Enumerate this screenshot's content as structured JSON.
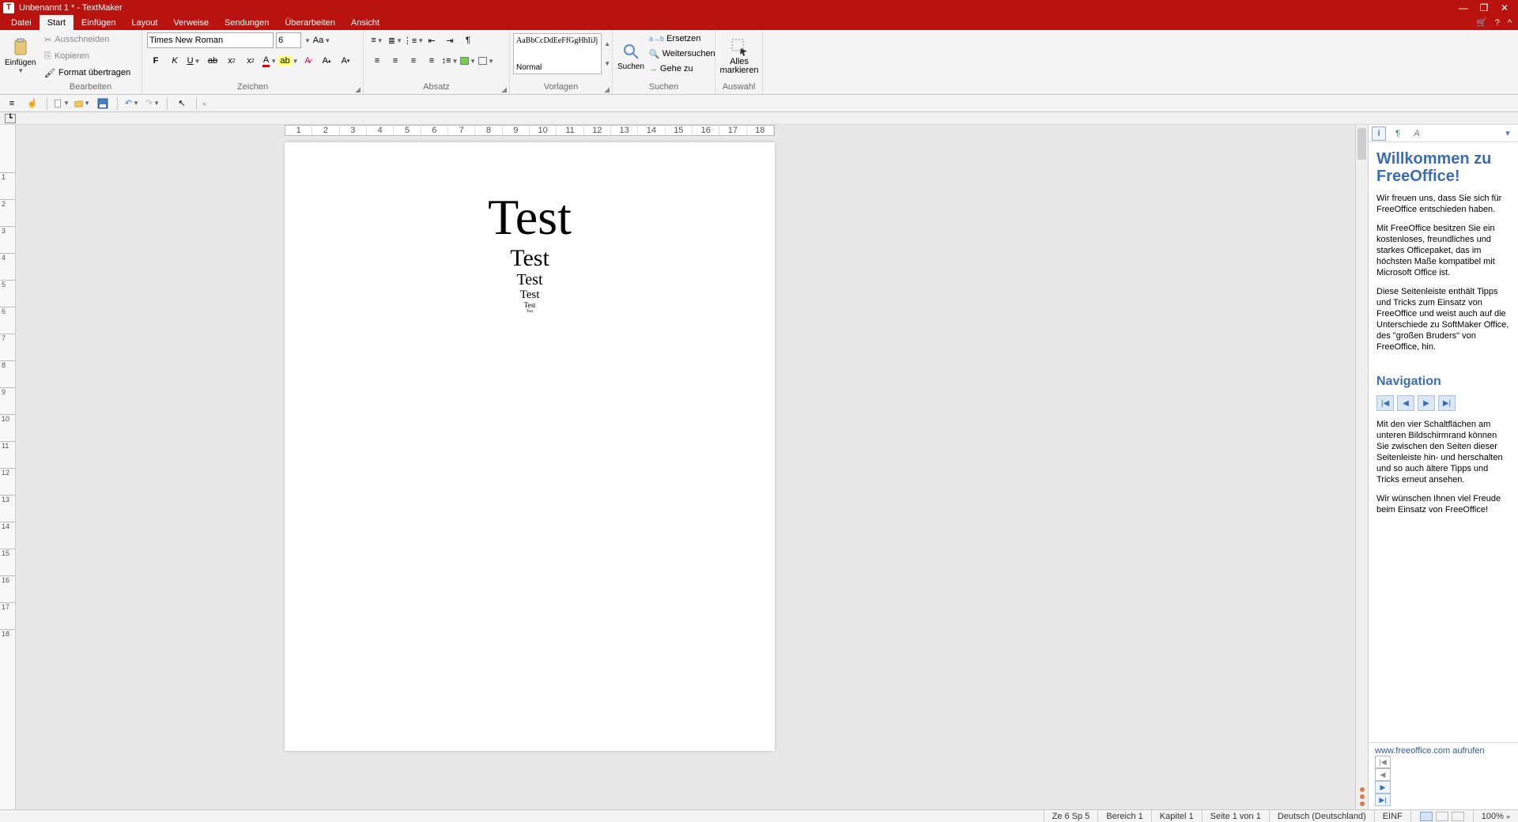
{
  "window": {
    "title": "Unbenannt 1 * - TextMaker",
    "app_initial": "T"
  },
  "tabs": {
    "datei": "Datei",
    "start": "Start",
    "einfuegen": "Einfügen",
    "layout": "Layout",
    "verweise": "Verweise",
    "sendungen": "Sendungen",
    "ueberarbeiten": "Überarbeiten",
    "ansicht": "Ansicht"
  },
  "ribbon": {
    "einfuegen_btn": "Einfügen",
    "bearbeiten": {
      "ausschneiden": "Ausschneiden",
      "kopieren": "Kopieren",
      "format_uebertragen": "Format übertragen",
      "label": "Bearbeiten"
    },
    "zeichen": {
      "font": "Times New Roman",
      "size": "6",
      "label": "Zeichen"
    },
    "absatz": {
      "label": "Absatz"
    },
    "vorlagen": {
      "preview": "AaBbCcDdEeFfGgHhIiJj",
      "name": "Normal",
      "label": "Vorlagen"
    },
    "suchen": {
      "btn": "Suchen",
      "ersetzen": "Ersetzen",
      "weitersuchen": "Weitersuchen",
      "geheZu": "Gehe zu",
      "label": "Suchen"
    },
    "auswahl": {
      "btn1": "Alles",
      "btn2": "markieren",
      "label": "Auswahl"
    }
  },
  "ruler": [
    "1",
    "2",
    "3",
    "4",
    "5",
    "6",
    "7",
    "8",
    "9",
    "10",
    "11",
    "12",
    "13",
    "14",
    "15",
    "16",
    "17",
    "18"
  ],
  "vruler": [
    "1",
    "2",
    "3",
    "4",
    "5",
    "6",
    "7",
    "8",
    "9",
    "10",
    "11",
    "12",
    "13",
    "14",
    "15",
    "16",
    "17",
    "18"
  ],
  "doc": {
    "lines": [
      {
        "text": "Test",
        "size": 64
      },
      {
        "text": "Test",
        "size": 30
      },
      {
        "text": "Test",
        "size": 20
      },
      {
        "text": "Test",
        "size": 15
      },
      {
        "text": "Test",
        "size": 9
      },
      {
        "text": "Test",
        "size": 5
      }
    ]
  },
  "sidebar": {
    "welcome_title": "Willkommen zu FreeOffice!",
    "p1": "Wir freuen uns, dass Sie sich für FreeOffice entschieden haben.",
    "p2": "Mit FreeOffice besitzen Sie ein kostenloses, freundliches und starkes Officepaket, das im höchsten Maße kompatibel mit Microsoft Office ist.",
    "p3": "Diese Seitenleiste enthält Tipps und Tricks zum Einsatz von FreeOffice und weist auch auf die Unterschiede zu SoftMaker Office, des \"großen Bruders\" von FreeOffice, hin.",
    "nav_title": "Navigation",
    "p4": "Mit den vier Schaltflächen am unteren Bildschirmrand können Sie zwischen den Seiten dieser Seitenleiste hin- und herschalten und so auch ältere Tipps und Tricks erneut ansehen.",
    "p5": "Wir wünschen Ihnen viel Freude beim Einsatz von FreeOffice!",
    "link": "www.freeoffice.com aufrufen"
  },
  "status": {
    "pos": "Ze 6 Sp 5",
    "bereich": "Bereich 1",
    "kapitel": "Kapitel 1",
    "seite": "Seite 1 von 1",
    "lang": "Deutsch (Deutschland)",
    "mode": "EINF",
    "zoom": "100%"
  }
}
